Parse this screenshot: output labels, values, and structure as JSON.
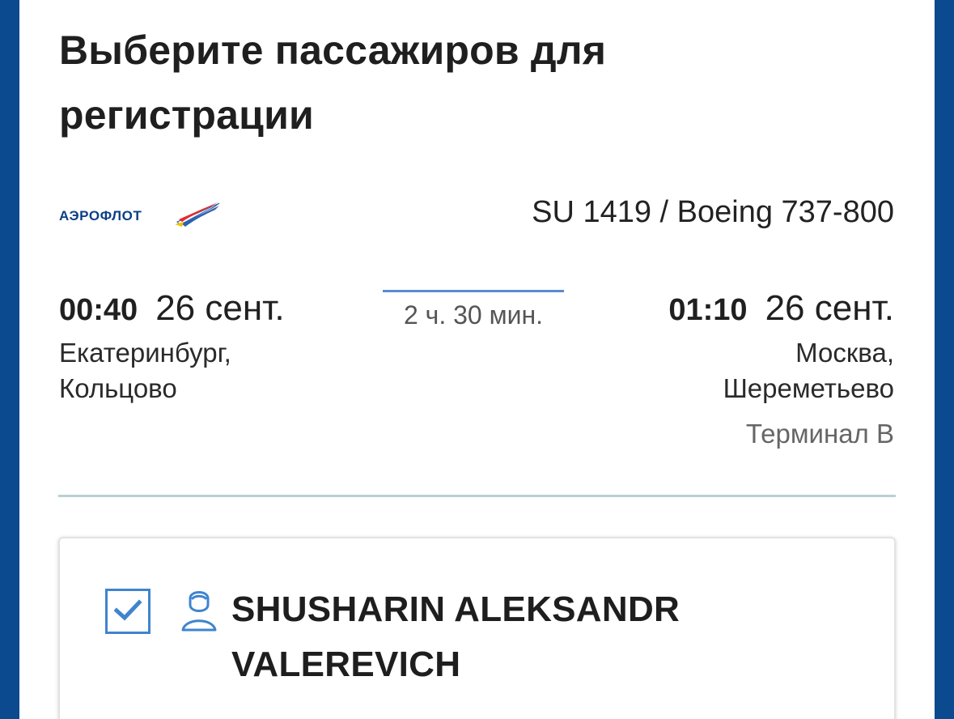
{
  "page": {
    "title": "Выберите пассажиров для регистрации"
  },
  "flight": {
    "airline_logo_text": "АЭРОФЛОТ",
    "number_aircraft": "SU 1419 / Boeing 737-800",
    "departure": {
      "time": "00:40",
      "date": "26 сент.",
      "city": "Екатеринбург,",
      "airport": "Кольцово"
    },
    "duration": "2 ч. 30 мин.",
    "arrival": {
      "time": "01:10",
      "date": "26 сент.",
      "city": "Москва,",
      "airport": "Шереметьево",
      "terminal": "Терминал B"
    }
  },
  "passengers": [
    {
      "name": "SHUSHARIN ALEKSANDR VALEREVICH",
      "selected": true,
      "icon": "person-icon"
    }
  ],
  "colors": {
    "frame": "#0b4a8f",
    "accent": "#3f84ce",
    "duration_line": "#5a8ccd",
    "divider": "#b9cfd6"
  }
}
